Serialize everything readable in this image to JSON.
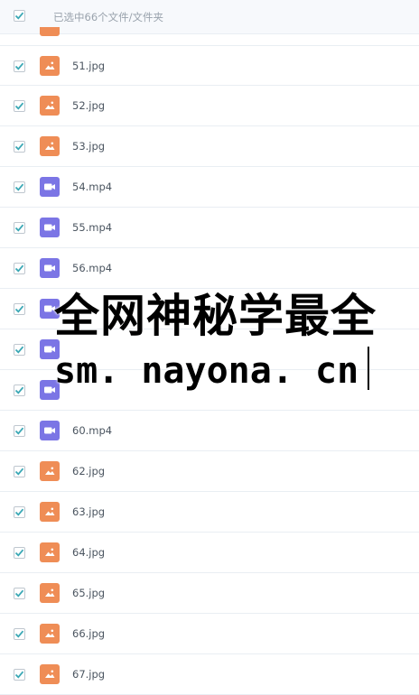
{
  "header": {
    "checked": true,
    "selection_text": "已选中66个文件/文件夹"
  },
  "colors": {
    "checkbox_accent": "#3aa8b5",
    "image_icon": "#ef8d56",
    "video_icon": "#7b75e5",
    "row_divider": "#e9eef3",
    "header_bg": "#f7f9fc"
  },
  "files": [
    {
      "name": "51.jpg",
      "type": "image",
      "checked": true,
      "icon": "image-file-icon"
    },
    {
      "name": "52.jpg",
      "type": "image",
      "checked": true,
      "icon": "image-file-icon"
    },
    {
      "name": "53.jpg",
      "type": "image",
      "checked": true,
      "icon": "image-file-icon"
    },
    {
      "name": "54.mp4",
      "type": "video",
      "checked": true,
      "icon": "video-file-icon"
    },
    {
      "name": "55.mp4",
      "type": "video",
      "checked": true,
      "icon": "video-file-icon"
    },
    {
      "name": "56.mp4",
      "type": "video",
      "checked": true,
      "icon": "video-file-icon"
    },
    {
      "name": "",
      "type": "video",
      "checked": true,
      "icon": "video-file-icon"
    },
    {
      "name": "",
      "type": "video",
      "checked": true,
      "icon": "video-file-icon"
    },
    {
      "name": "",
      "type": "video",
      "checked": true,
      "icon": "video-file-icon"
    },
    {
      "name": "60.mp4",
      "type": "video",
      "checked": true,
      "icon": "video-file-icon"
    },
    {
      "name": "62.jpg",
      "type": "image",
      "checked": true,
      "icon": "image-file-icon"
    },
    {
      "name": "63.jpg",
      "type": "image",
      "checked": true,
      "icon": "image-file-icon"
    },
    {
      "name": "64.jpg",
      "type": "image",
      "checked": true,
      "icon": "image-file-icon"
    },
    {
      "name": "65.jpg",
      "type": "image",
      "checked": true,
      "icon": "image-file-icon"
    },
    {
      "name": "66.jpg",
      "type": "image",
      "checked": true,
      "icon": "image-file-icon"
    },
    {
      "name": "67.jpg",
      "type": "image",
      "checked": true,
      "icon": "image-file-icon"
    }
  ],
  "watermark": {
    "line1": "全网神秘学最全",
    "line2": "sm. nayona. cn"
  }
}
